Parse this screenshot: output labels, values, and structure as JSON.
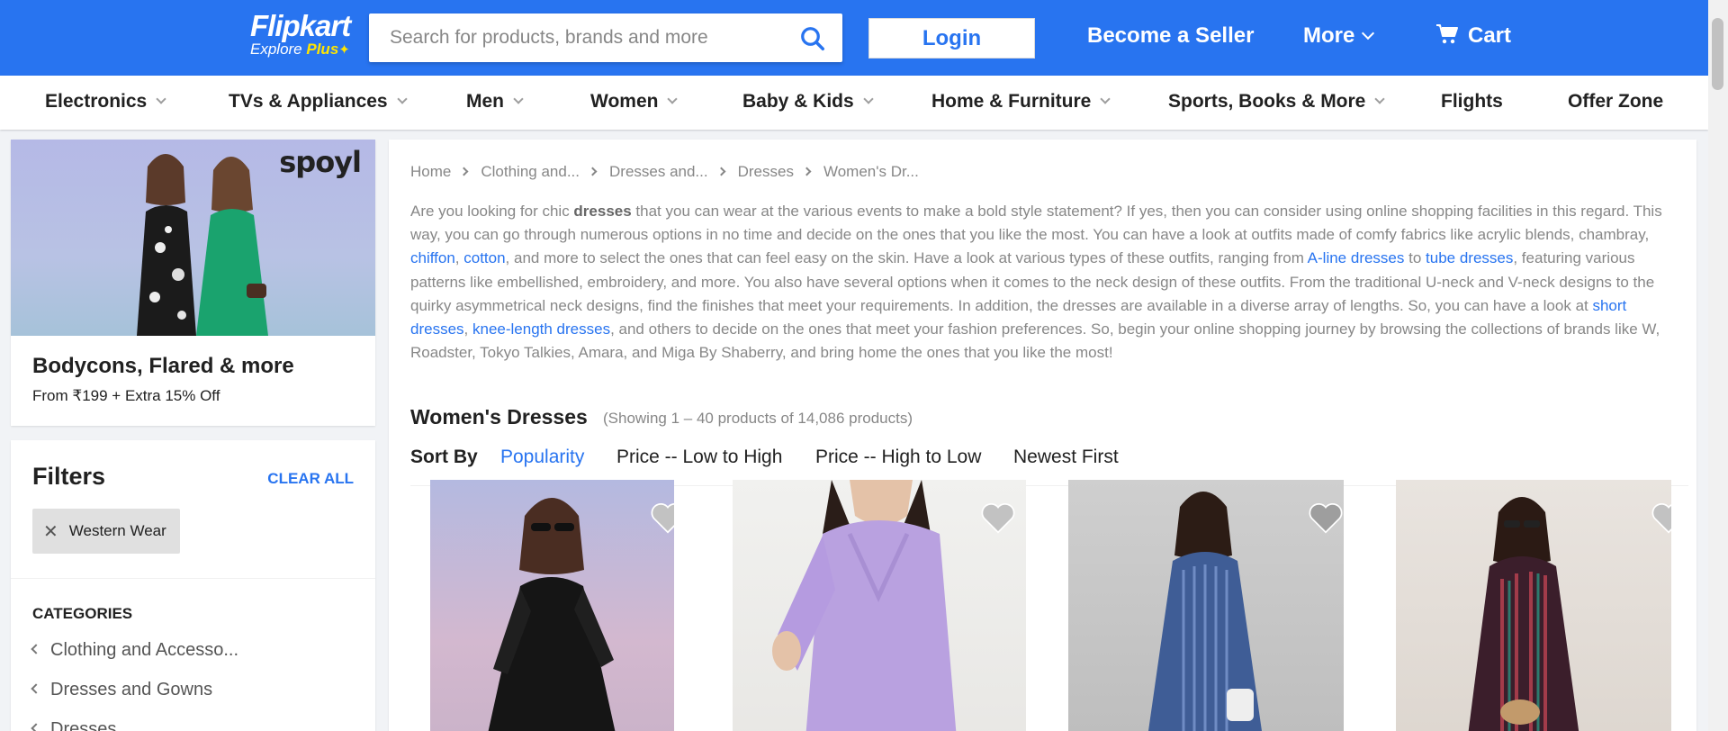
{
  "header": {
    "logo": {
      "brand": "Flipkart",
      "tagline_prefix": "Explore ",
      "tagline_plus": "Plus"
    },
    "search": {
      "placeholder": "Search for products, brands and more"
    },
    "login_label": "Login",
    "become_seller_label": "Become a Seller",
    "more_label": "More",
    "cart_label": "Cart",
    "colors": {
      "brand_blue": "#2874f0",
      "plus_yellow": "#ffe500"
    }
  },
  "nav": {
    "items": [
      {
        "label": "Electronics",
        "dropdown": true
      },
      {
        "label": "TVs & Appliances",
        "dropdown": true
      },
      {
        "label": "Men",
        "dropdown": true
      },
      {
        "label": "Women",
        "dropdown": true
      },
      {
        "label": "Baby & Kids",
        "dropdown": true
      },
      {
        "label": "Home & Furniture",
        "dropdown": true
      },
      {
        "label": "Sports, Books & More",
        "dropdown": true
      },
      {
        "label": "Flights",
        "dropdown": false
      },
      {
        "label": "Offer Zone",
        "dropdown": false
      }
    ]
  },
  "promo": {
    "brand": "spoyl",
    "title": "Bodycons, Flared & more",
    "subtitle": "From ₹199 + Extra 15% Off"
  },
  "filters": {
    "title": "Filters",
    "clear_all_label": "CLEAR ALL",
    "applied": [
      {
        "label": "Western Wear"
      }
    ],
    "categories_heading": "CATEGORIES",
    "categories": [
      {
        "label": "Clothing and Accesso..."
      },
      {
        "label": "Dresses and Gowns"
      },
      {
        "label": "Dresses"
      }
    ]
  },
  "main": {
    "breadcrumbs": [
      "Home",
      "Clothing and...",
      "Dresses and...",
      "Dresses",
      "Women's Dr..."
    ],
    "description": {
      "p1": "Are you looking for chic ",
      "b1": "dresses",
      "p2": " that you can wear at the various events to make a bold style statement? If yes, then you can consider using online shopping facilities in this regard. This way, you can go through numerous options in no time and decide on the ones that you like the most. You can have a look at outfits made of comfy fabrics like acrylic blends, chambray, ",
      "l1": "chiffon",
      "p3": ", ",
      "l2": "cotton",
      "p4": ", and more to select the ones that can feel easy on the skin. Have a look at various types of these outfits, ranging from ",
      "l3": "A-line dresses",
      "p5": " to ",
      "l4": "tube dresses",
      "p6": ", featuring various patterns like embellished, embroidery, and more. You also have several options when it comes to the neck design of these outfits. From the traditional U-neck and V-neck designs to the quirky asymmetrical neck designs, find the finishes that meet your requirements. In addition, the dresses are available in a diverse array of lengths. So, you can have a look at ",
      "l5": "short dresses",
      "p7": ", ",
      "l6": "knee-length dresses",
      "p8": ", and others to decide on the ones that meet your fashion preferences. So, begin your online shopping journey by browsing the collections of brands like W, Roadster, Tokyo Talkies, Amara, and Miga By Shaberry, and bring home the ones that you like the most!"
    },
    "list_title": "Women's Dresses",
    "result_count": "(Showing 1 – 40 products of 14,086 products)",
    "sort": {
      "label": "Sort By",
      "options": [
        {
          "label": "Popularity",
          "active": true
        },
        {
          "label": "Price -- Low to High",
          "active": false
        },
        {
          "label": "Price -- High to Low",
          "active": false
        },
        {
          "label": "Newest First",
          "active": false
        }
      ]
    },
    "products": [
      {
        "image": "woman-black-lace-dress"
      },
      {
        "image": "woman-lavender-bodycon-dress"
      },
      {
        "image": "woman-blue-striped-dress"
      },
      {
        "image": "woman-printed-ruffle-dress"
      }
    ]
  }
}
